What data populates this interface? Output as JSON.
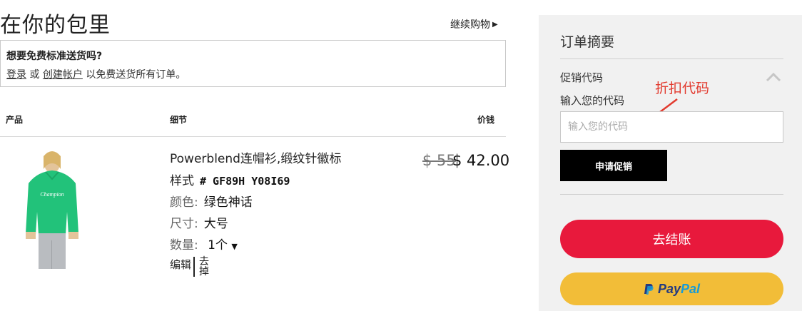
{
  "page": {
    "title": "在你的包里",
    "continue_shopping": "继续购物",
    "continue_icon": "triangle-right-icon"
  },
  "shipping": {
    "title": "想要免费标准送货吗?",
    "login": "登录",
    "or": "或",
    "create_account": "创建帐户",
    "suffix": "以免费送货所有订单。"
  },
  "table": {
    "headers": {
      "product": "产品",
      "details": "细节",
      "price": "价钱"
    }
  },
  "item": {
    "name": "Powerblend连帽衫,缎纹针徽标",
    "style_label": "样式",
    "style_value": "# GF89H Y08I69",
    "color_label": "颜色:",
    "color_value": "绿色神话",
    "size_label": "尺寸:",
    "size_value": "大号",
    "qty_label": "数量:",
    "qty_value": "1个",
    "price_original": "$ 55",
    "price_current": "$ 42.00",
    "edit": "编辑",
    "remove": "去掉",
    "image_color": "#22c27a"
  },
  "summary": {
    "title": "订单摘要",
    "promo_label": "促销代码",
    "code_label": "输入您的代码",
    "code_placeholder": "输入您的代码",
    "code_value": "",
    "apply_button": "申请促销",
    "checkout_button": "去结账",
    "paypal_pay": "Pay",
    "paypal_pal": "Pal",
    "annotation": "折扣代码"
  },
  "colors": {
    "checkout": "#e8193c",
    "paypal": "#f2bd38",
    "summary_bg": "#f1f1f1",
    "annotation": "#e23a2e"
  }
}
